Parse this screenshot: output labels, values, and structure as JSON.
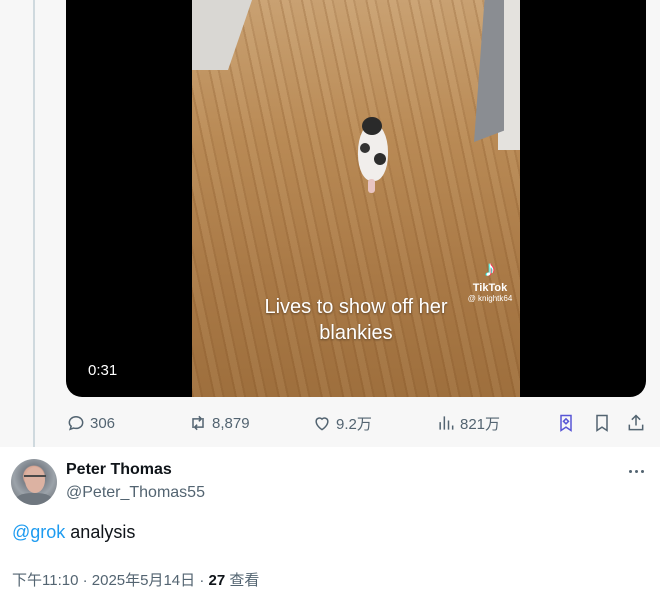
{
  "video": {
    "caption_line1": "Lives to show off her",
    "caption_line2": "blankies",
    "watermark_brand": "TikTok",
    "watermark_handle": "@ knightk64",
    "duration": "0:31"
  },
  "actions": {
    "replies": "306",
    "reposts": "8,879",
    "likes": "9.2万",
    "views": "821万"
  },
  "reply": {
    "author_name": "Peter Thomas",
    "author_handle": "@Peter_Thomas55",
    "mention": "@grok",
    "text": " analysis",
    "timestamp": "下午11:10 · 2025年5月14日 · ",
    "view_count": "27",
    "view_label": " 查看"
  },
  "icons": {
    "reply": "speech-bubble-icon",
    "repost": "repost-arrows-icon",
    "like": "heart-icon",
    "views": "bar-chart-icon",
    "grok": "grok-bookmark-icon",
    "bookmark": "bookmark-icon",
    "share": "share-upload-icon",
    "more": "more-dots-icon"
  },
  "colors": {
    "link": "#1d9bf0",
    "secondary_text": "#536471",
    "grok_accent": "#5856d6"
  }
}
